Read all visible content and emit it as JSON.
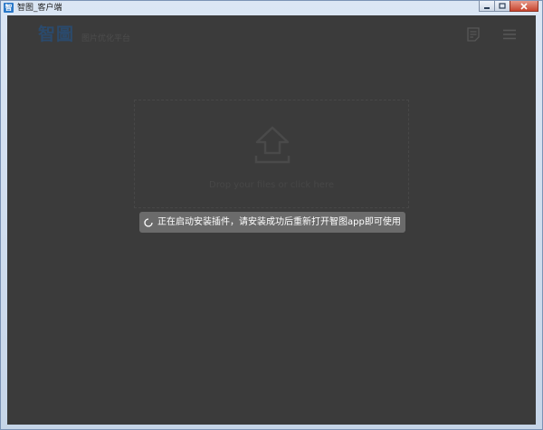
{
  "window": {
    "title": "智图_客户端",
    "icon_glyph": "智"
  },
  "header": {
    "logo_text": "智圖",
    "logo_subtitle": "图片优化平台",
    "icons": [
      "document-icon",
      "menu-icon"
    ]
  },
  "dropzone": {
    "label": "Drop your files or click here"
  },
  "toast": {
    "message": "正在启动安装插件，请安装成功后重新打开智图app即可使用"
  },
  "colors": {
    "background": "#3b3b3b",
    "toast": "#6b6b6b",
    "logo": "#2b4a6c"
  }
}
